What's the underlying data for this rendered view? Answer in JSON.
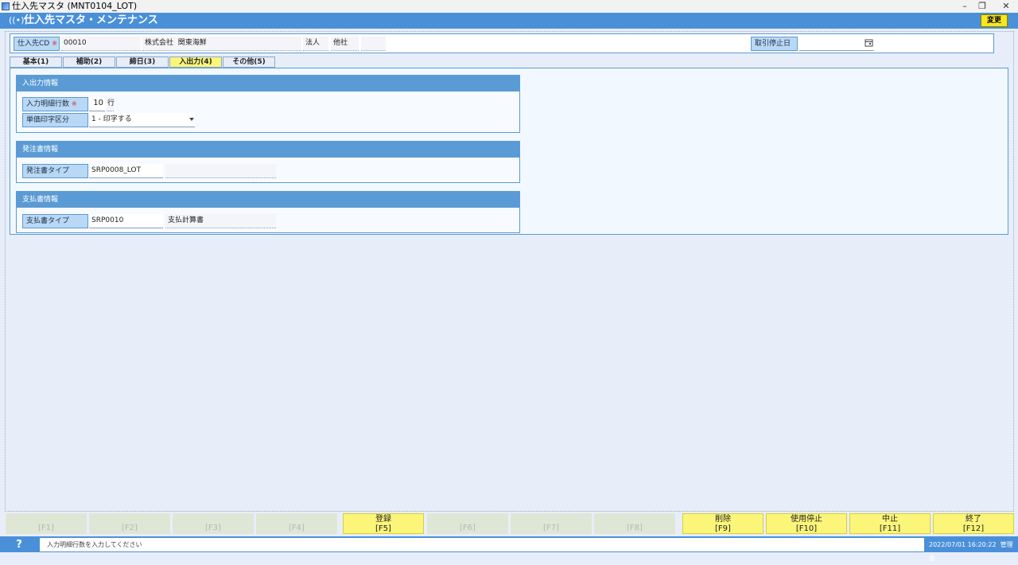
{
  "window": {
    "title": "仕入先マスタ (MNT0104_LOT)",
    "controls": [
      "–",
      "❐",
      "✕"
    ]
  },
  "app": {
    "icon": "broadcast-icon",
    "title": "仕入先マスタ・メンテナンス",
    "change_button": "変更"
  },
  "header": {
    "supplier_cd_label": "仕入先CD",
    "required_mark": "※",
    "supplier_cd_value": "00010",
    "company_type": "株式会社",
    "company_name": "関東海鮮",
    "corp_label": "法人",
    "other_label": "他社",
    "other_value": "",
    "stop_date_label": "取引停止日",
    "stop_date_value": ""
  },
  "tabs": [
    {
      "label": "基本(1)"
    },
    {
      "label": "補助(2)"
    },
    {
      "label": "締日(3)"
    },
    {
      "label": "入出力(4)"
    },
    {
      "label": "その他(5)"
    }
  ],
  "io_section": {
    "title": "入出力情報",
    "rows_label": "入力明細行数",
    "rows_value": "10",
    "rows_unit": "行",
    "unit_price_label": "単価印字区分",
    "unit_price_value": "1 - 印字する"
  },
  "order_section": {
    "title": "発注書情報",
    "type_label": "発注書タイプ",
    "type_value": "SRP0008_LOT",
    "type_name": ""
  },
  "payment_section": {
    "title": "支払書情報",
    "type_label": "支払書タイプ",
    "type_value": "SRP0010",
    "type_name": "支払計算書"
  },
  "fkeys": [
    {
      "label": "",
      "key": "[F1]"
    },
    {
      "label": "",
      "key": "[F2]"
    },
    {
      "label": "",
      "key": "[F3]"
    },
    {
      "label": "",
      "key": "[F4]"
    },
    {
      "label": "登録",
      "key": "[F5]"
    },
    {
      "label": "",
      "key": "[F6]"
    },
    {
      "label": "",
      "key": "[F7]"
    },
    {
      "label": "",
      "key": "[F8]"
    },
    {
      "label": "削除",
      "key": "[F9]"
    },
    {
      "label": "使用停止",
      "key": "[F10]"
    },
    {
      "label": "中止",
      "key": "[F11]"
    },
    {
      "label": "終了",
      "key": "[F12]"
    }
  ],
  "status": {
    "help": "?",
    "message": "入力明細行数を入力してください",
    "datetime": "2022/07/01 16:20:22",
    "user": "管理者"
  },
  "colors": {
    "accent": "#4a90d9",
    "section_header": "#5b9bd5",
    "label_bg": "#b9d8f5",
    "highlight": "#fbf57a",
    "required": "#e03030"
  }
}
